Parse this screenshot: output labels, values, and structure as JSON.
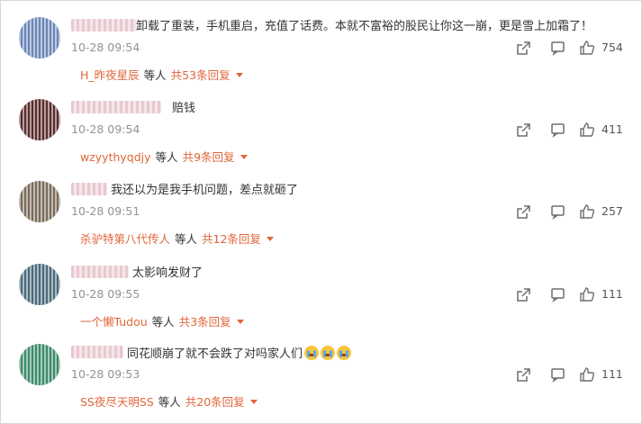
{
  "comments": [
    {
      "text": "卸载了重装，手机重启，充值了话费。本就不富裕的股民让你这一崩，更是雪上加霜了！",
      "time": "10-28 09:54",
      "likes": "754",
      "reply_user": "H_昨夜星辰",
      "reply_mid": "等人",
      "reply_count": "共53条回复",
      "avatar_color": "#6b86b8"
    },
    {
      "text": "赔钱",
      "time": "10-28 09:54",
      "likes": "411",
      "reply_user": "wzyythyqdjy",
      "reply_mid": "等人",
      "reply_count": "共9条回复",
      "avatar_color": "#5a2a2a"
    },
    {
      "text": "我还以为是我手机问题，差点就砸了",
      "time": "10-28 09:51",
      "likes": "257",
      "reply_user": "杀驴特第八代传人",
      "reply_mid": "等人",
      "reply_count": "共12条回复",
      "avatar_color": "#7a6a58"
    },
    {
      "text": "太影响发财了",
      "time": "10-28 09:55",
      "likes": "111",
      "reply_user": "一个懒Tudou",
      "reply_mid": "等人",
      "reply_count": "共3条回复",
      "avatar_color": "#4a6a7a"
    },
    {
      "text": "同花顺崩了就不会跌了对吗家人们",
      "time": "10-28 09:53",
      "likes": "111",
      "reply_user": "SS夜尽天明SS",
      "reply_mid": "等人",
      "reply_count": "共20条回复",
      "avatar_color": "#3a8a6a"
    }
  ],
  "icons": {
    "share": "share-icon",
    "comment": "comment-icon",
    "like": "thumbs-up-icon",
    "emoji": "crying-emoji-icon"
  },
  "colors": {
    "accent": "#e0663a",
    "time": "#939393",
    "icon": "#6f6f6f"
  }
}
